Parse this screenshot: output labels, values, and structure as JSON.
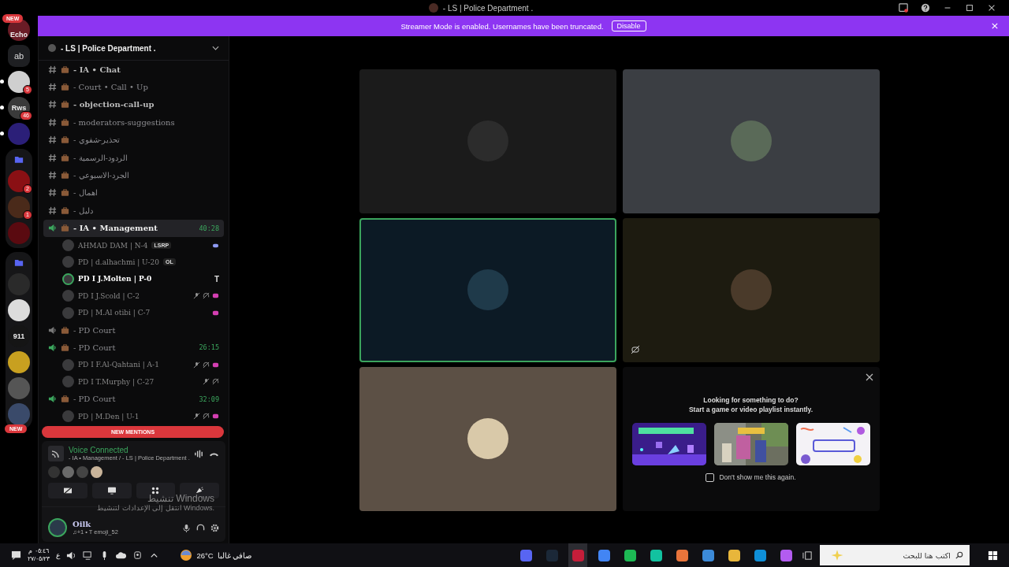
{
  "title_bar": {
    "title": "- LS | Police Department ."
  },
  "banner": {
    "text": "Streamer Mode is enabled. Usernames have been truncated.",
    "button": "Disable"
  },
  "servers": [
    {
      "kind": "avatar",
      "label": "Echo",
      "badge": "NEW",
      "color": "#6a1c26",
      "unread": false
    },
    {
      "kind": "text",
      "label": "ab",
      "unread": false
    },
    {
      "kind": "avatar",
      "badge": "5",
      "color": "#cfcfcf",
      "unread": true
    },
    {
      "kind": "avatar",
      "label": "Rws",
      "badge": "46",
      "color": "#3a3a3a",
      "unread": true
    },
    {
      "kind": "avatar",
      "color": "#2b1f78",
      "unread": true
    },
    {
      "kind": "folder",
      "children": [
        {
          "badge": "2",
          "color": "#8a1014"
        },
        {
          "badge": "1",
          "color": "#4a2a1a"
        },
        {
          "color": "#5a0a10"
        }
      ]
    },
    {
      "kind": "folder",
      "children": [
        {
          "color": "#2a2a2a"
        },
        {
          "color": "#dcdcdc"
        },
        {
          "label": "911",
          "color": "#151515"
        },
        {
          "color": "#c8a020"
        },
        {
          "color": "#555555"
        },
        {
          "color": "#3a4a6a"
        }
      ]
    }
  ],
  "server_new_pill": "NEW",
  "server_header": {
    "name": "- LS | Police Department ."
  },
  "channels": [
    {
      "kind": "text",
      "name": "- IA • Chat",
      "bold": true
    },
    {
      "kind": "text",
      "name": "- Court • Call • Up",
      "bold": false
    },
    {
      "kind": "text",
      "name": "- objection-call-up",
      "bold": true
    },
    {
      "kind": "text",
      "name": "- moderators-suggestions",
      "bold": false
    },
    {
      "kind": "text",
      "name": "- تحذير-شفوي",
      "bold": false
    },
    {
      "kind": "text",
      "name": "- الردود-الرسمية",
      "bold": false
    },
    {
      "kind": "text",
      "name": "- الجرد-الاسبوعي",
      "bold": false
    },
    {
      "kind": "text",
      "name": "- اهمال",
      "bold": false
    },
    {
      "kind": "text",
      "name": "- دليل",
      "bold": false
    },
    {
      "kind": "voice",
      "name": "- IA • Management",
      "active": true,
      "selected": true,
      "timer": "40:28",
      "members": [
        {
          "name": "AHMAD DAM | N-4",
          "tag": "LSRP",
          "speaking": false,
          "muted": false,
          "deafened": false,
          "activity": false,
          "gaming": true
        },
        {
          "name": "PD | d.alhachmi | U-20",
          "tag": "OL",
          "speaking": false,
          "muted": false,
          "deafened": false,
          "activity": false,
          "gaming": false
        },
        {
          "name": "PD I J.Molten | P-0",
          "speaking": true,
          "glyph": "T",
          "muted": false,
          "deafened": false,
          "activity": false,
          "gaming": false
        },
        {
          "name": "PD I J.Scold | C-2",
          "speaking": false,
          "muted": true,
          "deafened": true,
          "activity": true,
          "gaming": false
        },
        {
          "name": "PD | M.Al otibi | C-7",
          "speaking": false,
          "muted": false,
          "deafened": false,
          "activity": true,
          "gaming": false
        }
      ]
    },
    {
      "kind": "voice",
      "name": "- PD Court",
      "active": false,
      "selected": false
    },
    {
      "kind": "voice",
      "name": "- PD Court",
      "active": true,
      "selected": false,
      "timer": "26:15",
      "members": [
        {
          "name": "PD I F.Al-Qahtani | A-1",
          "speaking": false,
          "muted": true,
          "deafened": true,
          "activity": true,
          "gaming": false
        },
        {
          "name": "PD I T.Murphy | C-27",
          "speaking": false,
          "muted": true,
          "deafened": true,
          "activity": false,
          "gaming": false
        }
      ]
    },
    {
      "kind": "voice",
      "name": "- PD Court",
      "active": true,
      "selected": false,
      "timer": "32:09",
      "members": [
        {
          "name": "PD | M.Den | U-1",
          "speaking": false,
          "muted": true,
          "deafened": true,
          "activity": true,
          "gaming": false
        }
      ]
    }
  ],
  "new_mentions": "NEW MENTIONS",
  "voice_panel": {
    "status": "Voice Connected",
    "location": "- IA • Management / - LS | Police Department .",
    "participants": [
      {
        "color": "#333333"
      },
      {
        "color": "#6a6a6a"
      },
      {
        "color": "#444444"
      },
      {
        "color": "#c9b49a"
      }
    ]
  },
  "user_panel": {
    "name": "Oilk",
    "status": "♫+1 • T emoji_52"
  },
  "activation_notice": {
    "title": "تنشيط Windows",
    "text": "انتقل إلى الإعدادات لتنشيط Windows."
  },
  "tiles": [
    {
      "kind": "video",
      "color": "#1b1b1b",
      "avatar": {
        "color": "#2c2c2c"
      },
      "speaking": false,
      "muted": false
    },
    {
      "kind": "video",
      "color": "#3b3e43",
      "avatar": {
        "color": "#5a6a58"
      },
      "speaking": false,
      "muted": false
    },
    {
      "kind": "video",
      "color": "#0c1a25",
      "avatar": {
        "color": "#1f3a4a"
      },
      "speaking": true,
      "muted": false
    },
    {
      "kind": "video",
      "color": "#1d1b10",
      "avatar": {
        "color": "#4a3a2a"
      },
      "speaking": false,
      "muted": true
    },
    {
      "kind": "video",
      "color": "#5c5045",
      "avatar": {
        "color": "#d9c9a9"
      },
      "speaking": false,
      "muted": false
    },
    {
      "kind": "activities",
      "title": "Looking for something to do?",
      "subtitle": "Start a game or video playlist instantly.",
      "checkbox": {
        "label": "Don't show me this again.",
        "checked": false
      }
    }
  ],
  "taskbar": {
    "time": "٠٥:٤٦ م",
    "date": "٢٧/٠٥/٢٣",
    "language": "ع",
    "temperature": "26°C",
    "weather": "صافي غالبا",
    "search": {
      "placeholder": "اكتب هنا للبحث"
    },
    "apps": [
      {
        "color": "#5865f2",
        "selected": false
      },
      {
        "color": "#1b2838",
        "selected": false
      },
      {
        "color": "#c41e3a",
        "selected": true
      },
      {
        "color": "#4285f4",
        "selected": false
      },
      {
        "color": "#1db954",
        "selected": false
      },
      {
        "color": "#12c2a0",
        "selected": false
      },
      {
        "color": "#e8743b",
        "selected": false
      },
      {
        "color": "#3c8ad8",
        "selected": false
      },
      {
        "color": "#e8b63b",
        "selected": false
      },
      {
        "color": "#0f8fd8",
        "selected": false
      },
      {
        "color": "#b35cf0",
        "selected": false
      }
    ]
  }
}
